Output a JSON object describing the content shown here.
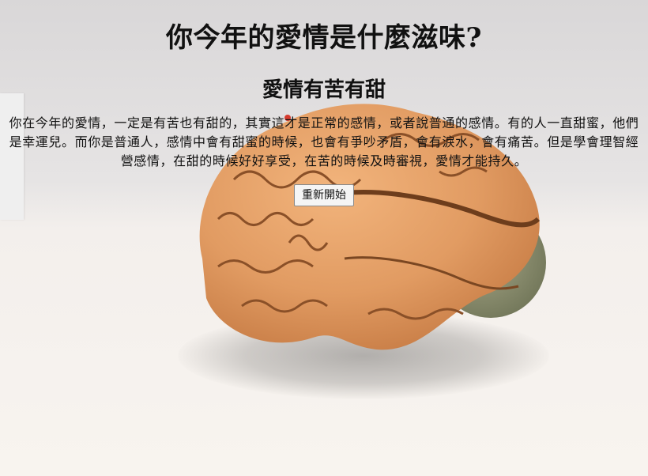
{
  "page": {
    "title": "你今年的愛情是什麼滋味?",
    "background_image": "brain-model-photo"
  },
  "result": {
    "title": "愛情有苦有甜",
    "description": "你在今年的愛情，一定是有苦也有甜的，其實這才是正常的感情，或者說普通的感情。有的人一直甜蜜，他們是幸運兒。而你是普通人，感情中會有甜蜜的時候，也會有爭吵矛盾，會有淚水，會有痛苦。但是學會理智經營感情，在甜的時候好好享受，在苦的時候及時審視，愛情才能持久。"
  },
  "actions": {
    "restart_label": "重新開始"
  }
}
